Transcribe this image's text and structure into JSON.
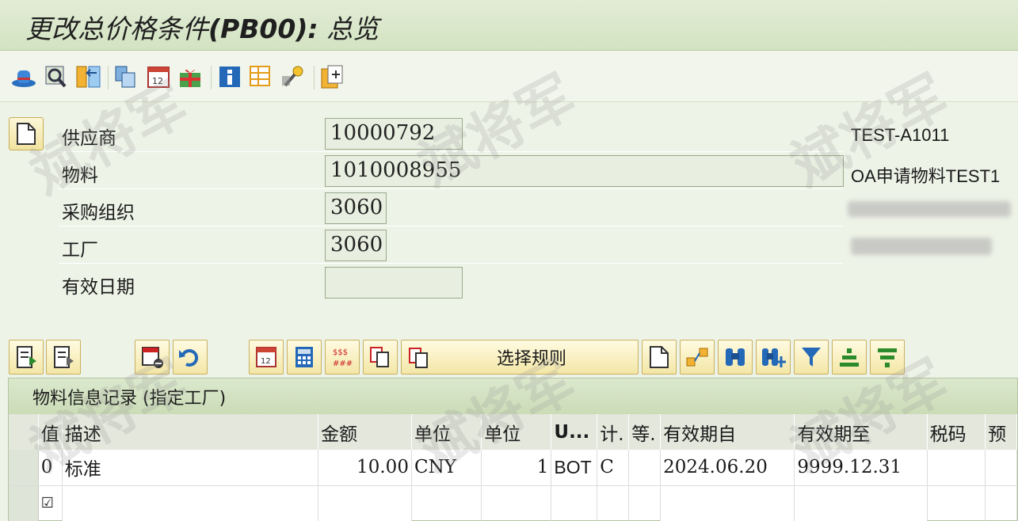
{
  "window": {
    "title": "更改总价格条件",
    "title_code": "(PB00):",
    "title_suffix": "总览"
  },
  "toolbar_icons": [
    "hat-icon",
    "search-icon",
    "return-icon",
    "copy-icon",
    "calendar-icon",
    "gift-icon",
    "info-icon",
    "table-icon",
    "key-icon",
    "paste-icon"
  ],
  "header": {
    "fields": [
      {
        "label": "供应商",
        "value": "10000792",
        "extra": "TEST-A1011"
      },
      {
        "label": "物料",
        "value": "1010008955",
        "extra": "OA申请物料TEST1"
      },
      {
        "label": "采购组织",
        "value": "3060",
        "extra": ""
      },
      {
        "label": "工厂",
        "value": "3060",
        "extra": ""
      },
      {
        "label": "有效日期",
        "value": "",
        "extra": ""
      }
    ]
  },
  "grid_toolbar": {
    "select_rule_label": "选择规则"
  },
  "grid": {
    "title": "物料信息记录 (指定工厂)",
    "columns": [
      "值",
      "描述",
      "金额",
      "单位",
      "单位",
      "U...",
      "计.",
      "等.",
      "有效期自",
      "有效期至",
      "税码",
      "预"
    ],
    "rows": [
      {
        "col0": "0",
        "desc": "标准",
        "amount": "10.00",
        "unit": "CNY",
        "per": "1",
        "uom": "BOT",
        "calc": "C",
        "scale": "",
        "valid_from": "2024.06.20",
        "valid_to": "9999.12.31",
        "tax": "",
        "pre": ""
      }
    ],
    "check_mark": "☑"
  },
  "watermark_text": "斌将军",
  "colors": {
    "title_bg": "#d7e6c6",
    "button_yellow": "#f3e6a6",
    "grid_header": "#e3e7dc"
  }
}
